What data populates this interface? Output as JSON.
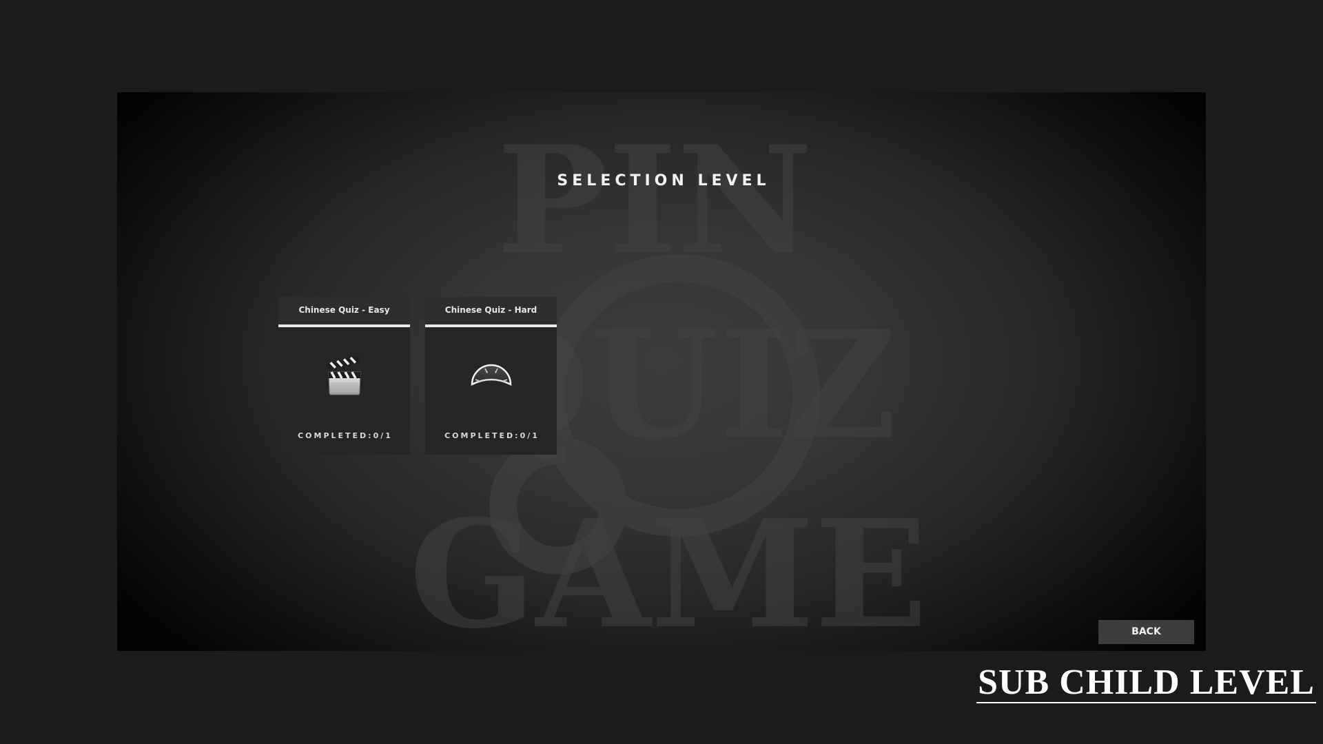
{
  "screen": {
    "title": "SELECTION LEVEL",
    "back_label": "BACK"
  },
  "watermark": {
    "top_word": "PIN",
    "middle_word": "QUIZ",
    "bottom_word": "GAME"
  },
  "levels": [
    {
      "title": "Chinese Quiz - Easy",
      "icon": "clapperboard-icon",
      "status": "COMPLETED:0/1"
    },
    {
      "title": "Chinese Quiz - Hard",
      "icon": "gauge-icon",
      "status": "COMPLETED:0/1"
    }
  ],
  "caption": "SUB CHILD LEVEL",
  "colors": {
    "background": "#1b1b1b",
    "panel_center": "#3c3c3c",
    "card": "#252525",
    "accent_line": "#e9e9e9",
    "button": "#3d3d3d"
  }
}
